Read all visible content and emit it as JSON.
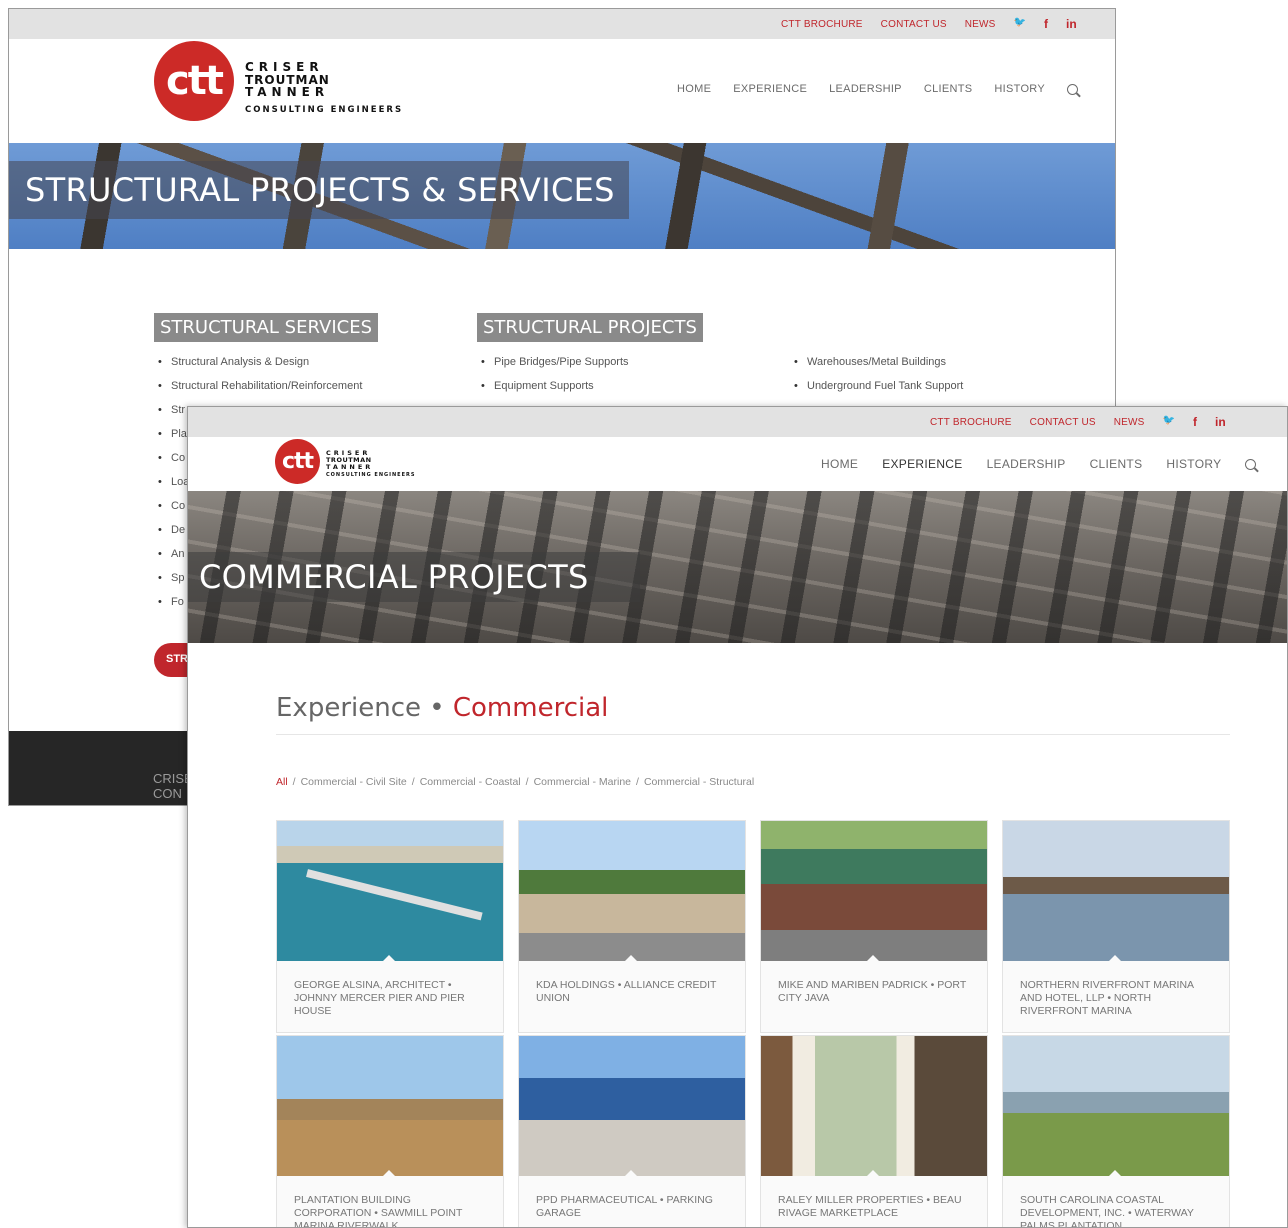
{
  "back_window": {
    "top_links": [
      "CTT BROCHURE",
      "CONTACT US",
      "NEWS"
    ],
    "social": [
      "twitter-icon",
      "facebook-icon",
      "linkedin-icon"
    ],
    "social_glyphs": {
      "twitter": "🐦",
      "facebook": "f",
      "linkedin": "in"
    },
    "logo": {
      "mark": "ctt",
      "line1": "CRISER",
      "line2": "TROUTMAN",
      "line3": "TANNER",
      "tagline": "CONSULTING ENGINEERS"
    },
    "nav": [
      "HOME",
      "EXPERIENCE",
      "LEADERSHIP",
      "CLIENTS",
      "HISTORY"
    ],
    "hero_title": "STRUCTURAL PROJECTS & SERVICES",
    "services_label": "STRUCTURAL SERVICES",
    "projects_label": "STRUCTURAL PROJECTS",
    "services": [
      "Structural Analysis & Design",
      "Structural Rehabilitation/Reinforcement",
      "Str",
      "Pla",
      "Co",
      "Loa",
      "Co",
      "De",
      "An",
      "Sp",
      "Fo"
    ],
    "projects_col1": [
      "Pipe Bridges/Pipe Supports",
      "Equipment Supports"
    ],
    "projects_col2": [
      "Warehouses/Metal Buildings",
      "Underground Fuel Tank Support"
    ],
    "cta_label": "STR",
    "footer_text": "CRISER CON"
  },
  "front_window": {
    "top_links": [
      "CTT BROCHURE",
      "CONTACT US",
      "NEWS"
    ],
    "social_glyphs": {
      "twitter": "🐦",
      "facebook": "f",
      "linkedin": "in"
    },
    "logo": {
      "mark": "ctt",
      "line1": "CRISER",
      "line2": "TROUTMAN",
      "line3": "TANNER",
      "tagline": "CONSULTING ENGINEERS"
    },
    "nav": [
      "HOME",
      "EXPERIENCE",
      "LEADERSHIP",
      "CLIENTS",
      "HISTORY"
    ],
    "nav_active": "EXPERIENCE",
    "hero_title": "COMMERCIAL PROJECTS",
    "breadcrumb": {
      "parent": "Experience",
      "separator": "•",
      "current": "Commercial"
    },
    "filters": [
      "All",
      "Commercial - Civil Site",
      "Commercial - Coastal",
      "Commercial - Marine",
      "Commercial - Structural"
    ],
    "filter_separator": "/",
    "projects": [
      {
        "caption": "GEORGE ALSINA, ARCHITECT • JOHNNY MERCER PIER AND PIER HOUSE",
        "image": "pier"
      },
      {
        "caption": "KDA HOLDINGS • ALLIANCE CREDIT UNION",
        "image": "bank"
      },
      {
        "caption": "MIKE AND MARIBEN PADRICK • PORT CITY JAVA",
        "image": "cafe"
      },
      {
        "caption": "NORTHERN RIVERFRONT MARINA AND HOTEL, LLP • NORTH RIVERFRONT MARINA",
        "image": "marina"
      },
      {
        "caption": "PLANTATION BUILDING CORPORATION • SAWMILL POINT MARINA RIVERWALK",
        "image": "walk"
      },
      {
        "caption": "PPD PHARMACEUTICAL • PARKING GARAGE",
        "image": "garage"
      },
      {
        "caption": "RALEY MILLER PROPERTIES • BEAU RIVAGE MARKETPLACE",
        "image": "porch"
      },
      {
        "caption": "SOUTH CAROLINA COASTAL DEVELOPMENT, INC. • WATERWAY PALMS PLANTATION",
        "image": "marsh"
      }
    ]
  },
  "colors": {
    "brand_red": "#c0262c",
    "logo_red": "#cc2a27",
    "topbar_gray": "#e2e2e2",
    "label_gray": "#8a8a8a"
  }
}
